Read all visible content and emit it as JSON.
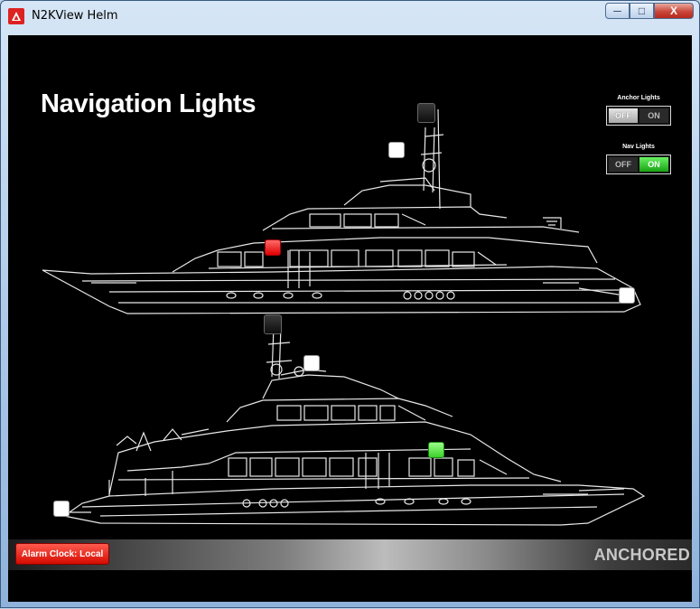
{
  "window": {
    "title": "N2KView Helm"
  },
  "window_controls": {
    "minimize": "─",
    "maximize": "□",
    "close": "X"
  },
  "page": {
    "title": "Navigation Lights"
  },
  "switches": {
    "anchor": {
      "label": "Anchor Lights",
      "off": "OFF",
      "on": "ON",
      "state": "off"
    },
    "nav": {
      "label": "Nav Lights",
      "off": "OFF",
      "on": "ON",
      "state": "on"
    }
  },
  "lights": {
    "side_view": {
      "mast_top": "off",
      "mast_side": "white",
      "port_side": "red",
      "stern": "white"
    },
    "starboard_view": {
      "mast_top": "off",
      "mast_side": "white",
      "starboard_side": "green",
      "stern": "white"
    }
  },
  "colors": {
    "red": "#e00000",
    "green": "#3bd12a",
    "white": "#ffffff",
    "off": "#1a1a1a"
  },
  "status": {
    "alarm_button": "Alarm Clock: Local",
    "mode": "ANCHORED"
  }
}
